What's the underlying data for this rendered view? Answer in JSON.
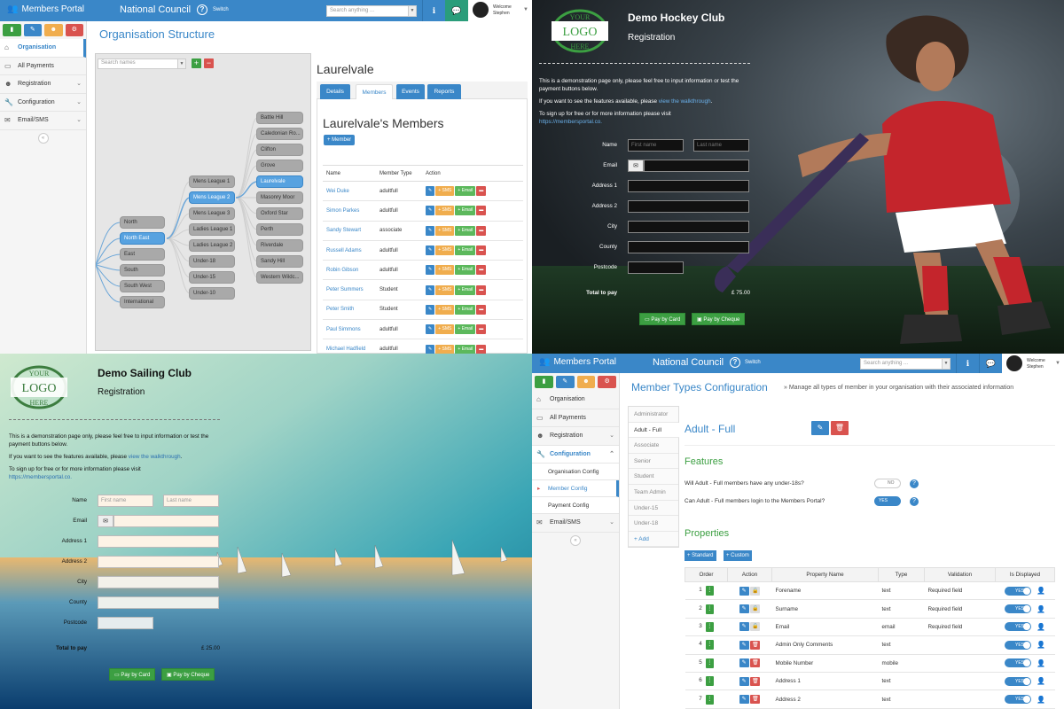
{
  "portal": {
    "brand": "Members Portal",
    "council": "National Council",
    "switch": "Switch",
    "search_placeholder": "Search anything ...",
    "welcome": "Welcome",
    "user": "Stephen",
    "colors": {
      "primary": "#3a87c8",
      "green": "#3c9f42",
      "orange": "#f0ad4e",
      "red": "#d9534f",
      "teal": "#2a9d7a"
    }
  },
  "sidebar_q1": {
    "items": [
      {
        "label": "Organisation",
        "icon": "home-icon"
      },
      {
        "label": "All Payments",
        "icon": "card-icon"
      },
      {
        "label": "Registration",
        "icon": "users-icon"
      },
      {
        "label": "Configuration",
        "icon": "wrench-icon"
      },
      {
        "label": "Email/SMS",
        "icon": "chat-icon"
      }
    ]
  },
  "org": {
    "title": "Organisation Structure",
    "search_placeholder": "Search names",
    "tree": {
      "regions": [
        "North",
        "North East",
        "East",
        "South",
        "South West",
        "International"
      ],
      "leagues": [
        "Mens League 1",
        "Mens League 2",
        "Mens League 3",
        "Ladies League 1",
        "Ladies League 2",
        "Under-18",
        "Under-15",
        "Under-10"
      ],
      "clubs": [
        "Battle Hill",
        "Caledonian Ro...",
        "Clifton",
        "Grove",
        "Laurelvale",
        "Masonry Moor",
        "Oxford Star",
        "Perth",
        "Riverdale",
        "Sandy Hill",
        "Western Wildc..."
      ]
    },
    "detail": {
      "title": "Laurelvale",
      "tabs": [
        "Details",
        "Members",
        "Events",
        "Reports"
      ],
      "members_title": "Laurelvale's Members",
      "add_member": "+ Member",
      "columns": [
        "Name",
        "Member Type",
        "Action"
      ],
      "action_labels": {
        "sms": "SMS",
        "email": "Email"
      },
      "rows": [
        {
          "name": "Wei Duke",
          "type": "adultfull"
        },
        {
          "name": "Simon Parkes",
          "type": "adultfull"
        },
        {
          "name": "Sandy Stewart",
          "type": "associate"
        },
        {
          "name": "Russell Adams",
          "type": "adultfull"
        },
        {
          "name": "Robin Gibson",
          "type": "adultfull"
        },
        {
          "name": "Peter Summers",
          "type": "Student"
        },
        {
          "name": "Peter Smith",
          "type": "Student"
        },
        {
          "name": "Paul Simmons",
          "type": "adultfull"
        },
        {
          "name": "Michael Hadfield",
          "type": "adultfull"
        }
      ]
    }
  },
  "hockey": {
    "logo_lines": [
      "YOUR",
      "LOGO",
      "HERE"
    ],
    "club": "Demo Hockey Club",
    "subtitle": "Registration",
    "p1": "This is a demonstration page only, please feel free to input information or test the payment buttons below.",
    "p2_pre": "If you want to see the features available, please ",
    "p2_link": "view the walkthrough",
    "p2_post": ".",
    "p3": "To sign up for free or for more information please visit",
    "p3_link": "https://membersportal.co.",
    "labels": {
      "name": "Name",
      "email": "Email",
      "a1": "Address 1",
      "a2": "Address 2",
      "city": "City",
      "county": "County",
      "postcode": "Postcode",
      "total": "Total to pay"
    },
    "first_placeholder": "First name",
    "last_placeholder": "Last name",
    "total": "£ 75.00",
    "pay_card": "Pay by Card",
    "pay_cheque": "Pay by Cheque"
  },
  "sailing": {
    "logo_lines": [
      "YOUR",
      "LOGO",
      "HERE"
    ],
    "club": "Demo Sailing Club",
    "subtitle": "Registration",
    "p1": "This is a demonstration page only, please feel free to input information or test the payment buttons below.",
    "p2_pre": "If you want to see the features available, please ",
    "p2_link": "view the walkthrough",
    "p2_post": ".",
    "p3": "To sign up for free or for more information please visit",
    "p3_link": "https://membersportal.co.",
    "labels": {
      "name": "Name",
      "email": "Email",
      "a1": "Address 1",
      "a2": "Address 2",
      "city": "City",
      "county": "County",
      "postcode": "Postcode",
      "total": "Total to pay"
    },
    "first_placeholder": "First name",
    "last_placeholder": "Last name",
    "total": "£ 25.00",
    "pay_card": "Pay by Card",
    "pay_cheque": "Pay by Cheque"
  },
  "sidebar_q4": {
    "items": [
      {
        "label": "Organisation",
        "icon": "home-icon"
      },
      {
        "label": "All Payments",
        "icon": "card-icon"
      },
      {
        "label": "Registration",
        "icon": "users-icon"
      },
      {
        "label": "Configuration",
        "icon": "wrench-icon"
      },
      {
        "label": "Organisation Config"
      },
      {
        "label": "Member Config"
      },
      {
        "label": "Payment Config"
      },
      {
        "label": "Email/SMS",
        "icon": "chat-icon"
      }
    ]
  },
  "member_types": {
    "title": "Member Types Configuration",
    "description": "» Manage all types of member in your organisation with their associated information",
    "types": [
      "Administrator",
      "Adult - Full",
      "Associate",
      "Senior",
      "Student",
      "Team Admin",
      "Under-15",
      "Under-18"
    ],
    "add": "+ Add",
    "selected": "Adult - Full",
    "features_title": "Features",
    "q1": "Will Adult - Full members have any under-18s?",
    "q1_toggle": "NO",
    "q2": "Can Adult - Full members login to the Members Portal?",
    "q2_toggle": "YES",
    "properties_title": "Properties",
    "btn_standard": "+ Standard",
    "btn_custom": "+ Custom",
    "columns": [
      "Order",
      "Action",
      "Property Name",
      "Type",
      "Validation",
      "Is Displayed"
    ],
    "displayed_label": "YES",
    "rows": [
      {
        "order": "1",
        "name": "Forename",
        "type": "text",
        "validation": "Required field"
      },
      {
        "order": "2",
        "name": "Surname",
        "type": "text",
        "validation": "Required field"
      },
      {
        "order": "3",
        "name": "Email",
        "type": "email",
        "validation": "Required field"
      },
      {
        "order": "4",
        "name": "Admin Only Comments",
        "type": "text",
        "validation": ""
      },
      {
        "order": "5",
        "name": "Mobile Number",
        "type": "mobile",
        "validation": ""
      },
      {
        "order": "6",
        "name": "Address 1",
        "type": "text",
        "validation": ""
      },
      {
        "order": "7",
        "name": "Address 2",
        "type": "text",
        "validation": ""
      }
    ]
  }
}
